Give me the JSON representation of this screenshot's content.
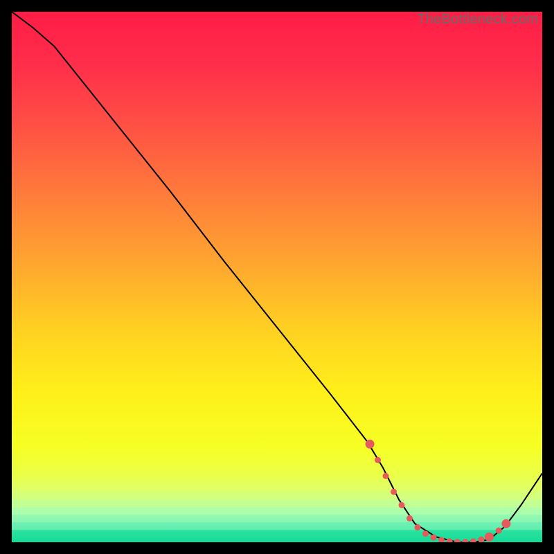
{
  "watermark": "TheBottleneck.com",
  "chart_data": {
    "type": "line",
    "title": "",
    "xlabel": "",
    "ylabel": "",
    "xlim": [
      0,
      100
    ],
    "ylim": [
      0,
      100
    ],
    "grid": false,
    "series": [
      {
        "name": "bottleneck-curve",
        "x": [
          0,
          4,
          8,
          10,
          20,
          30,
          40,
          50,
          60,
          67,
          70,
          73,
          76,
          80,
          84,
          87,
          90,
          93,
          96,
          100
        ],
        "y": [
          100,
          97,
          93.5,
          91,
          78.5,
          66,
          53,
          40.5,
          28,
          19,
          14,
          8,
          3.5,
          1,
          0,
          0,
          0.5,
          3,
          7,
          13
        ],
        "stroke": "#000000",
        "stroke_width": 2
      }
    ],
    "markers": {
      "name": "highlight-dots",
      "color": "#e55a5a",
      "radius_small": 4.5,
      "radius_large": 6.5,
      "points": [
        {
          "x": 67.5,
          "y": 18.5,
          "r": "large"
        },
        {
          "x": 69.0,
          "y": 15.5,
          "r": "small"
        },
        {
          "x": 70.5,
          "y": 12.5,
          "r": "small"
        },
        {
          "x": 72.0,
          "y": 9.5,
          "r": "small"
        },
        {
          "x": 73.5,
          "y": 7.0,
          "r": "small"
        },
        {
          "x": 75.0,
          "y": 4.5,
          "r": "small"
        },
        {
          "x": 76.5,
          "y": 2.8,
          "r": "small"
        },
        {
          "x": 78.0,
          "y": 1.6,
          "r": "small"
        },
        {
          "x": 79.5,
          "y": 0.9,
          "r": "small"
        },
        {
          "x": 81.0,
          "y": 0.4,
          "r": "small"
        },
        {
          "x": 82.5,
          "y": 0.15,
          "r": "small"
        },
        {
          "x": 84.0,
          "y": 0.05,
          "r": "small"
        },
        {
          "x": 85.5,
          "y": 0.05,
          "r": "small"
        },
        {
          "x": 87.0,
          "y": 0.15,
          "r": "small"
        },
        {
          "x": 88.5,
          "y": 0.5,
          "r": "small"
        },
        {
          "x": 90.0,
          "y": 1.0,
          "r": "large"
        },
        {
          "x": 91.8,
          "y": 2.2,
          "r": "small"
        },
        {
          "x": 93.2,
          "y": 3.5,
          "r": "large"
        }
      ]
    },
    "background_gradient": {
      "stops": [
        {
          "offset": 0.0,
          "color": "#ff1c46"
        },
        {
          "offset": 0.1,
          "color": "#ff2e4a"
        },
        {
          "offset": 0.22,
          "color": "#ff5244"
        },
        {
          "offset": 0.35,
          "color": "#ff7d3a"
        },
        {
          "offset": 0.48,
          "color": "#ffa82f"
        },
        {
          "offset": 0.6,
          "color": "#ffd122"
        },
        {
          "offset": 0.72,
          "color": "#fff01a"
        },
        {
          "offset": 0.82,
          "color": "#f6ff24"
        },
        {
          "offset": 0.875,
          "color": "#eaff4a"
        },
        {
          "offset": 0.905,
          "color": "#ddff6e"
        },
        {
          "offset": 0.925,
          "color": "#ccff8f"
        },
        {
          "offset": 0.945,
          "color": "#b3ffab"
        },
        {
          "offset": 0.965,
          "color": "#86f5b5"
        },
        {
          "offset": 0.985,
          "color": "#41e6a8"
        },
        {
          "offset": 1.0,
          "color": "#06d68f"
        }
      ]
    },
    "green_bands": [
      {
        "y": 0.905,
        "h": 0.013,
        "color": "#d2ff7b",
        "opacity": 0.55
      },
      {
        "y": 0.92,
        "h": 0.012,
        "color": "#bdff93",
        "opacity": 0.55
      },
      {
        "y": 0.934,
        "h": 0.012,
        "color": "#a3ffab",
        "opacity": 0.55
      },
      {
        "y": 0.948,
        "h": 0.012,
        "color": "#83f7b3",
        "opacity": 0.6
      },
      {
        "y": 0.962,
        "h": 0.013,
        "color": "#5deeb0",
        "opacity": 0.6
      },
      {
        "y": 0.977,
        "h": 0.023,
        "color": "#18dd9a",
        "opacity": 0.7
      }
    ]
  }
}
